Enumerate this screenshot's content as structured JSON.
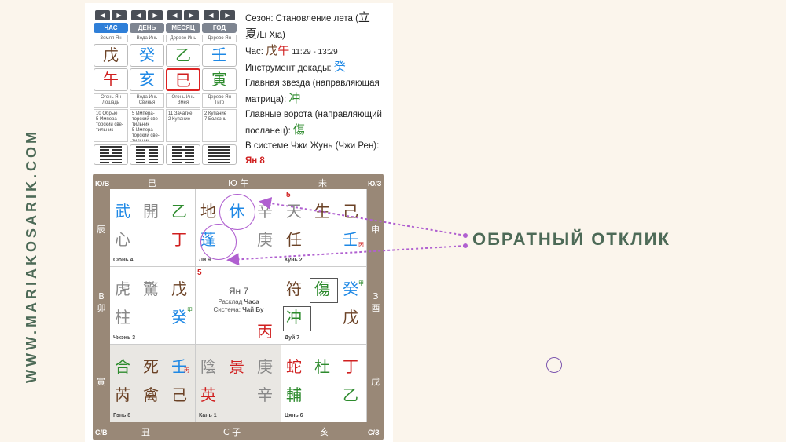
{
  "side": {
    "url": "WWW.MARIAKOSARIK.COM"
  },
  "pillars": [
    {
      "tab": "ЧАС",
      "active": true,
      "sub": "Земля Ян",
      "stem": "戊",
      "stem_color": "#6b4226",
      "branch": "午",
      "branch_color": "#d01f1f",
      "desc": "Огонь Ян Лошадь",
      "notes": "10 Обрые\n5 Импера-торский све-тильник",
      "hex": [
        1,
        0,
        0,
        1,
        1,
        0
      ]
    },
    {
      "tab": "ДЕНЬ",
      "active": false,
      "sub": "Вода Инь",
      "stem": "癸",
      "stem_color": "#1e88e5",
      "branch": "亥",
      "branch_color": "#1e88e5",
      "desc": "Вода Инь Свинья",
      "notes": "5 Импера-торский све-тильник\n5 Импера-торский све-тильник",
      "hex": [
        1,
        0,
        0,
        0,
        0,
        0
      ]
    },
    {
      "tab": "МЕСЯЦ",
      "active": false,
      "sub": "Дерево Инь",
      "stem": "乙",
      "stem_color": "#2e8b2e",
      "branch": "巳",
      "branch_color": "#d01f1f",
      "desc": "Огонь Инь Змея",
      "notes": "11 Зачатие\n2 Купание",
      "hex": [
        0,
        1,
        0,
        0,
        1,
        0
      ]
    },
    {
      "tab": "ГОД",
      "active": false,
      "sub": "Дерево Ян",
      "stem": "壬",
      "stem_color": "#1e88e5",
      "branch": "寅",
      "branch_color": "#2e8b2e",
      "desc": "Дерево Ян Тигр",
      "notes": "2 Купание\n7 Болезнь",
      "hex": [
        1,
        1,
        1,
        1,
        1,
        1
      ]
    }
  ],
  "info": {
    "season_label": "Сезон: Становление лета (",
    "season_char": "立夏",
    "season_end": "/Li Xia)",
    "hour_label": "Час:",
    "hour_stem": "戊",
    "hour_branch": "午",
    "hour_time": "11:29 - 13:29",
    "decade_label": "Инструмент декады:",
    "decade_char": "癸",
    "star_label": "Главная звезда (направляющая матрица):",
    "star_char": "冲",
    "gate_label": "Главные ворота (направляющий посланец):",
    "gate_char": "傷",
    "system_label": "В системе Чжи Жунь (Чжи Рен):",
    "system_value": "Ян 8"
  },
  "board": {
    "sides": {
      "nw": "Ю/В",
      "ne": "Ю/З",
      "sw": "С/В",
      "se": "С/З",
      "top": [
        "巳",
        "Ю 午",
        "未"
      ],
      "bottom": [
        "丑",
        "С 子",
        "亥"
      ],
      "left": [
        "辰",
        "В 卯",
        "寅"
      ],
      "right": [
        "申",
        "З 酉",
        "戌"
      ]
    },
    "center": {
      "title": "Ян 7",
      "line1": "Расклад",
      "line1b": "Часа",
      "line2": "Система:",
      "line2b": "Чай Бу",
      "stem": "丙",
      "num": "5"
    },
    "cells": [
      {
        "name": "Сюнь 4",
        "chars": [
          [
            "武",
            "#1e88e5"
          ],
          [
            "開",
            "#888"
          ],
          [
            "乙",
            "#2e8b2e"
          ],
          [
            "心",
            "#888"
          ],
          [
            "丁",
            "#d01f1f"
          ]
        ]
      },
      {
        "name": "Ли 9",
        "chars": [
          [
            "地",
            "#6b4226"
          ],
          [
            "休",
            "#1e88e5"
          ],
          [
            "辛",
            "#888"
          ],
          [
            "蓬",
            "#1e88e5"
          ],
          [
            "庚",
            "#888"
          ]
        ]
      },
      {
        "name": "Кунь 2",
        "num": "5",
        "chars": [
          [
            "天",
            "#888"
          ],
          [
            "生",
            "#6b4226"
          ],
          [
            "己",
            "#6b4226"
          ],
          [
            "任",
            "#6b4226"
          ],
          [
            "壬",
            "#1e88e5"
          ]
        ],
        "sub": "丙"
      },
      {
        "name": "Чжэнь 3",
        "chars": [
          [
            "虎",
            "#888"
          ],
          [
            "驚",
            "#888"
          ],
          [
            "戊",
            "#6b4226"
          ],
          [
            "柱",
            "#888"
          ],
          [
            "癸",
            "#1e88e5"
          ]
        ],
        "sub": "甲"
      },
      {
        "name": "Дуй 7",
        "chars": [
          [
            "符",
            "#6b4226"
          ],
          [
            "傷",
            "#2e8b2e"
          ],
          [
            "癸",
            "#1e88e5"
          ],
          [
            "冲",
            "#2e8b2e"
          ],
          [
            "戊",
            "#6b4226"
          ]
        ],
        "sub": "甲"
      },
      {
        "name": "Гэнь 8",
        "chars": [
          [
            "合",
            "#2e8b2e"
          ],
          [
            "死",
            "#6b4226"
          ],
          [
            "壬",
            "#1e88e5"
          ],
          [
            "芮",
            "#6b4226"
          ],
          [
            "禽",
            "#6b4226"
          ],
          [
            "己",
            "#6b4226"
          ]
        ],
        "sub": "丙"
      },
      {
        "name": "Кань 1",
        "chars": [
          [
            "陰",
            "#888"
          ],
          [
            "景",
            "#d01f1f"
          ],
          [
            "庚",
            "#888"
          ],
          [
            "英",
            "#d01f1f"
          ],
          [
            "辛",
            "#888"
          ]
        ]
      },
      {
        "name": "Цянь 6",
        "chars": [
          [
            "蛇",
            "#d01f1f"
          ],
          [
            "杜",
            "#2e8b2e"
          ],
          [
            "丁",
            "#d01f1f"
          ],
          [
            "輔",
            "#2e8b2e"
          ],
          [
            "乙",
            "#2e8b2e"
          ]
        ]
      }
    ]
  },
  "response_label": "ОБРАТНЫЙ ОТКЛИК",
  "colors": {
    "background": "#fbf5ec",
    "accent_green": "#4d6a57",
    "arrow_purple": "#b060d0",
    "board": "#998877"
  }
}
